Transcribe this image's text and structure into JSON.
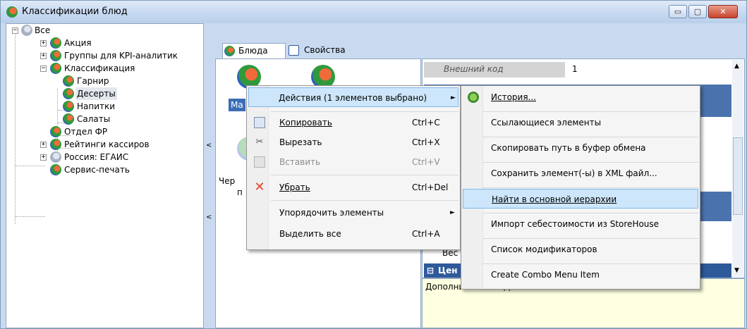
{
  "window": {
    "title": "Классификации блюд",
    "min_glyph": "▭",
    "max_glyph": "▢",
    "close_glyph": "✕"
  },
  "tree": {
    "root": "Все",
    "items": [
      "Акция",
      "Группы для KPI-аналитик",
      "Классификация",
      "Гарнир",
      "Десерты",
      "Напитки",
      "Салаты",
      "Отдел ФР",
      "Рейтинги кассиров",
      "Россия: ЕГАИС",
      "Сервис-печать"
    ]
  },
  "splitter": {
    "arrow_top": "<",
    "arrow_bottom": "<"
  },
  "tabs": {
    "dishes": "Блюда",
    "properties": "Свойства"
  },
  "mid": {
    "selected_label": "Ма",
    "text_1": "Чер",
    "text_2": "п"
  },
  "props": {
    "external_code_label": "Внешний код",
    "external_code_value": "1",
    "weight_label": "Вес",
    "price_category": "Цен"
  },
  "description": "Дополнительно.. Дополнительные свойства",
  "context_menu": {
    "actions": "Действия (1 элементов выбрано)",
    "copy": "Копировать",
    "copy_sc": "Ctrl+C",
    "cut": "Вырезать",
    "cut_sc": "Ctrl+X",
    "paste": "Вставить",
    "paste_sc": "Ctrl+V",
    "remove": "Убрать",
    "remove_sc": "Ctrl+Del",
    "sort": "Упорядочить элементы",
    "select_all": "Выделить все",
    "select_all_sc": "Ctrl+A",
    "arrow": "►"
  },
  "submenu": {
    "history": "История...",
    "referencing": "Ссылающиеся элементы",
    "copy_path": "Скопировать путь в буфер обмена",
    "save_xml": "Сохранить элемент(-ы) в XML файл...",
    "find_main": "Найти в основной иерархии",
    "import_cost": "Импорт себестоимости из StoreHouse",
    "modifiers": "Список модификаторов",
    "combo": "Create Combo Menu Item"
  },
  "colors": {
    "accent": "#3a6db5",
    "highlight": "#cde6fb",
    "frame": "#c9daf0"
  }
}
